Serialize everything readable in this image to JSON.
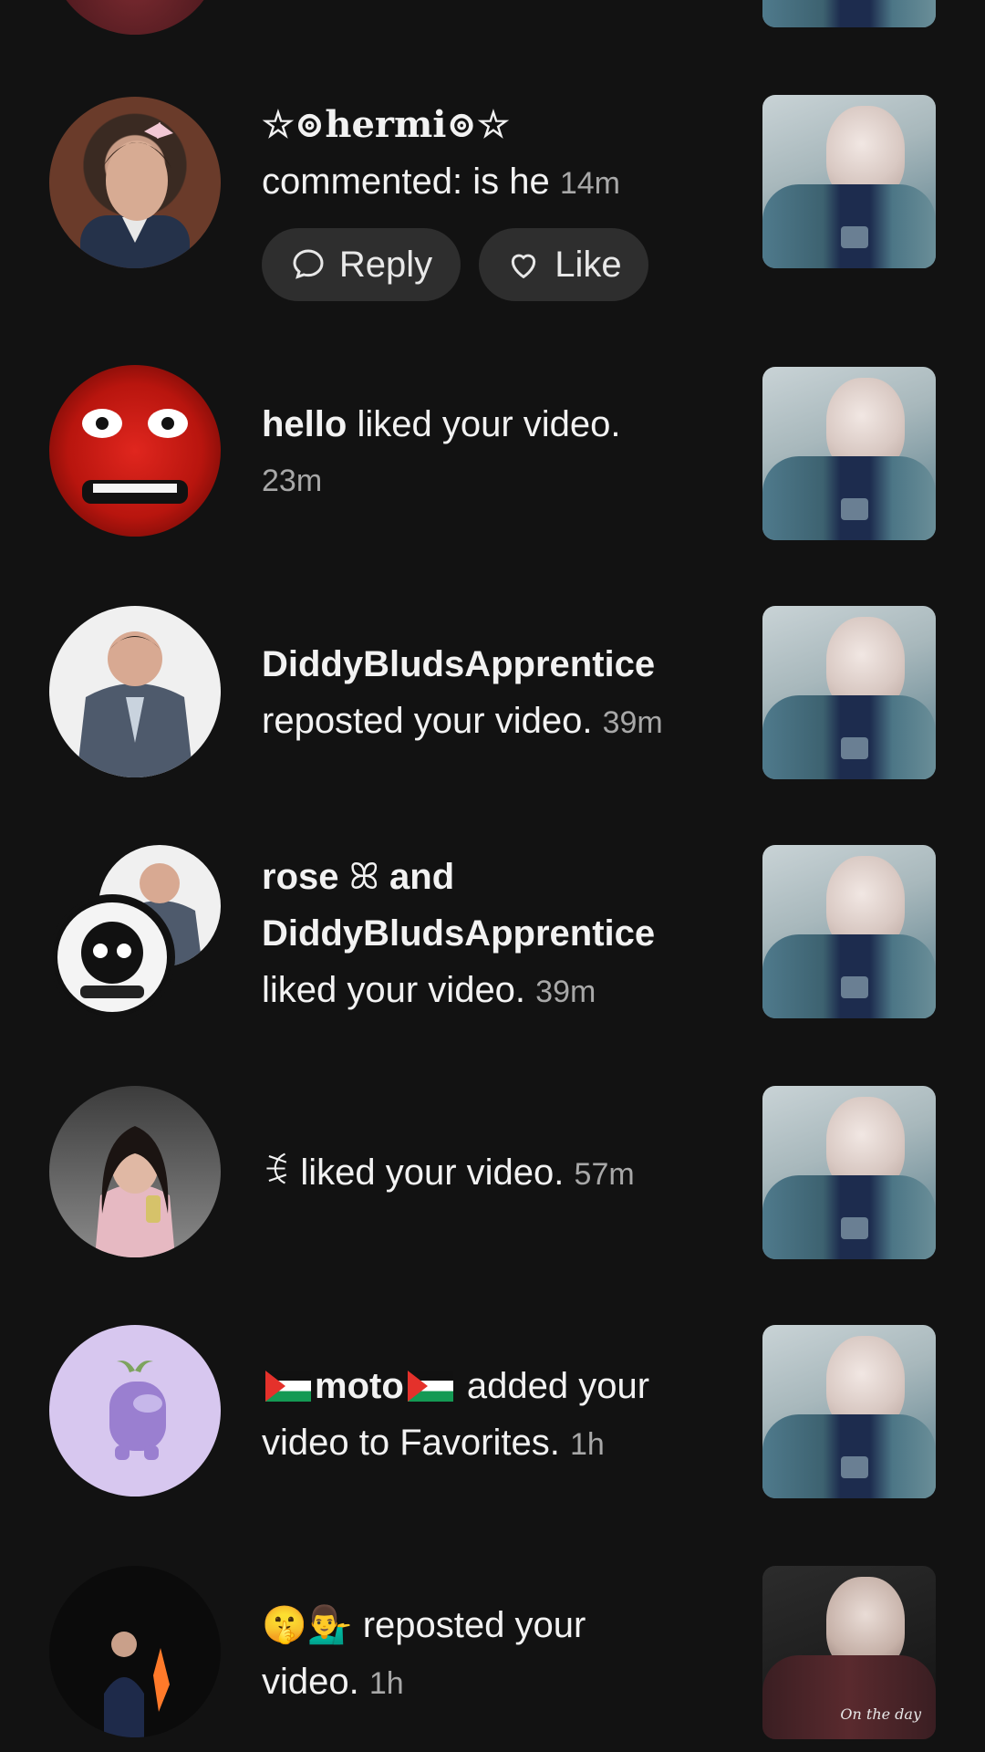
{
  "notifications": [
    {
      "actor": "☆⊚hermi⊚☆",
      "action_prefix": "commented: ",
      "comment": "is he",
      "time": "14m",
      "reply_label": "Reply",
      "like_label": "Like"
    },
    {
      "actor": "hello",
      "action": " liked your video.",
      "time": "23m"
    },
    {
      "actor": "DiddyBludsApprentice",
      "action": "reposted your video.",
      "time": "39m"
    },
    {
      "actor": "rose",
      "joiner": "and",
      "actor2": "DiddyBludsApprentice",
      "action": "liked your video.",
      "time": "39m"
    },
    {
      "actor": "ꉂ",
      "action": " liked your video.",
      "time": "57m"
    },
    {
      "actor": "moto",
      "action": " added your",
      "action2": "video to Favorites.",
      "time": "1h"
    },
    {
      "actor": "🤫💁‍♂️",
      "action": " reposted your",
      "action2": "video.",
      "time": "1h",
      "thumb_caption": "On the day"
    }
  ],
  "colors": {
    "background": "#121212",
    "text": "#f2f2f2",
    "muted": "#a8a8a8",
    "pill": "#2e2e2e"
  }
}
